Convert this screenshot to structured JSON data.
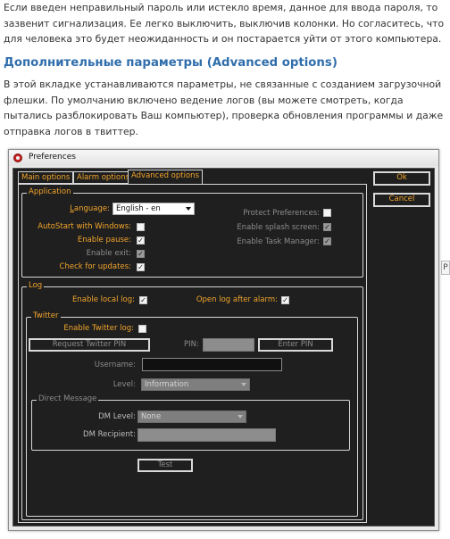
{
  "article": {
    "para1": "Если введен неправильный пароль или истекло время, данное для ввода пароля, то зазвенит сигнализация. Ее легко выключить, выключив колонки. Но согласитесь, что для человека это будет неожиданность и он постарается уйти от этого компьютера.",
    "heading": "Дополнительные параметры (Advanced options)",
    "para2": "В этой вкладке устанавливаются параметры, не связанные с созданием загрузочной флешки. По умолчанию включено ведение логов (вы можете смотреть, когда пытались разблокировать Ваш компьютер), проверка обновления программы и даже отправка логов в твиттер.",
    "side_control": "P"
  },
  "window": {
    "title": "Preferences",
    "tabs": [
      "Main options",
      "Alarm options",
      "Advanced options"
    ],
    "ok_label": "Ok",
    "cancel_label": "Cancel"
  },
  "application": {
    "title": "Application",
    "language_label": "Language:",
    "language_value": "English - en",
    "autostart_label": "AutoStart with Windows:",
    "enable_pause_label": "Enable pause:",
    "enable_exit_label": "Enable exit:",
    "check_updates_label": "Check for updates:",
    "protect_label": "Protect Preferences:",
    "splash_label": "Enable splash screen:",
    "task_manager_label": "Enable Task Manager:",
    "autostart_checked": false,
    "enable_pause_checked": true,
    "enable_exit_checked": true,
    "check_updates_checked": true,
    "protect_checked": false,
    "splash_checked": true,
    "task_manager_checked": true
  },
  "log": {
    "title": "Log",
    "enable_local_label": "Enable local log:",
    "open_after_alarm_label": "Open log after alarm:",
    "enable_local_checked": true,
    "open_after_alarm_checked": true
  },
  "twitter": {
    "title": "Twitter",
    "enable_label": "Enable Twitter log:",
    "enable_checked": false,
    "request_pin_label": "Request Twitter PIN",
    "pin_label": "PIN:",
    "enter_pin_label": "Enter PIN",
    "username_label": "Username:",
    "level_label": "Level:",
    "level_value": "Information"
  },
  "direct_message": {
    "title": "Direct Message",
    "dm_level_label": "DM Level:",
    "dm_level_value": "None",
    "dm_recipient_label": "DM Recipient:",
    "test_label": "Test"
  },
  "colors": {
    "accent_orange": "#f2a52c",
    "dialog_bg": "#1f1f1f",
    "heading_blue": "#2f6eac"
  }
}
